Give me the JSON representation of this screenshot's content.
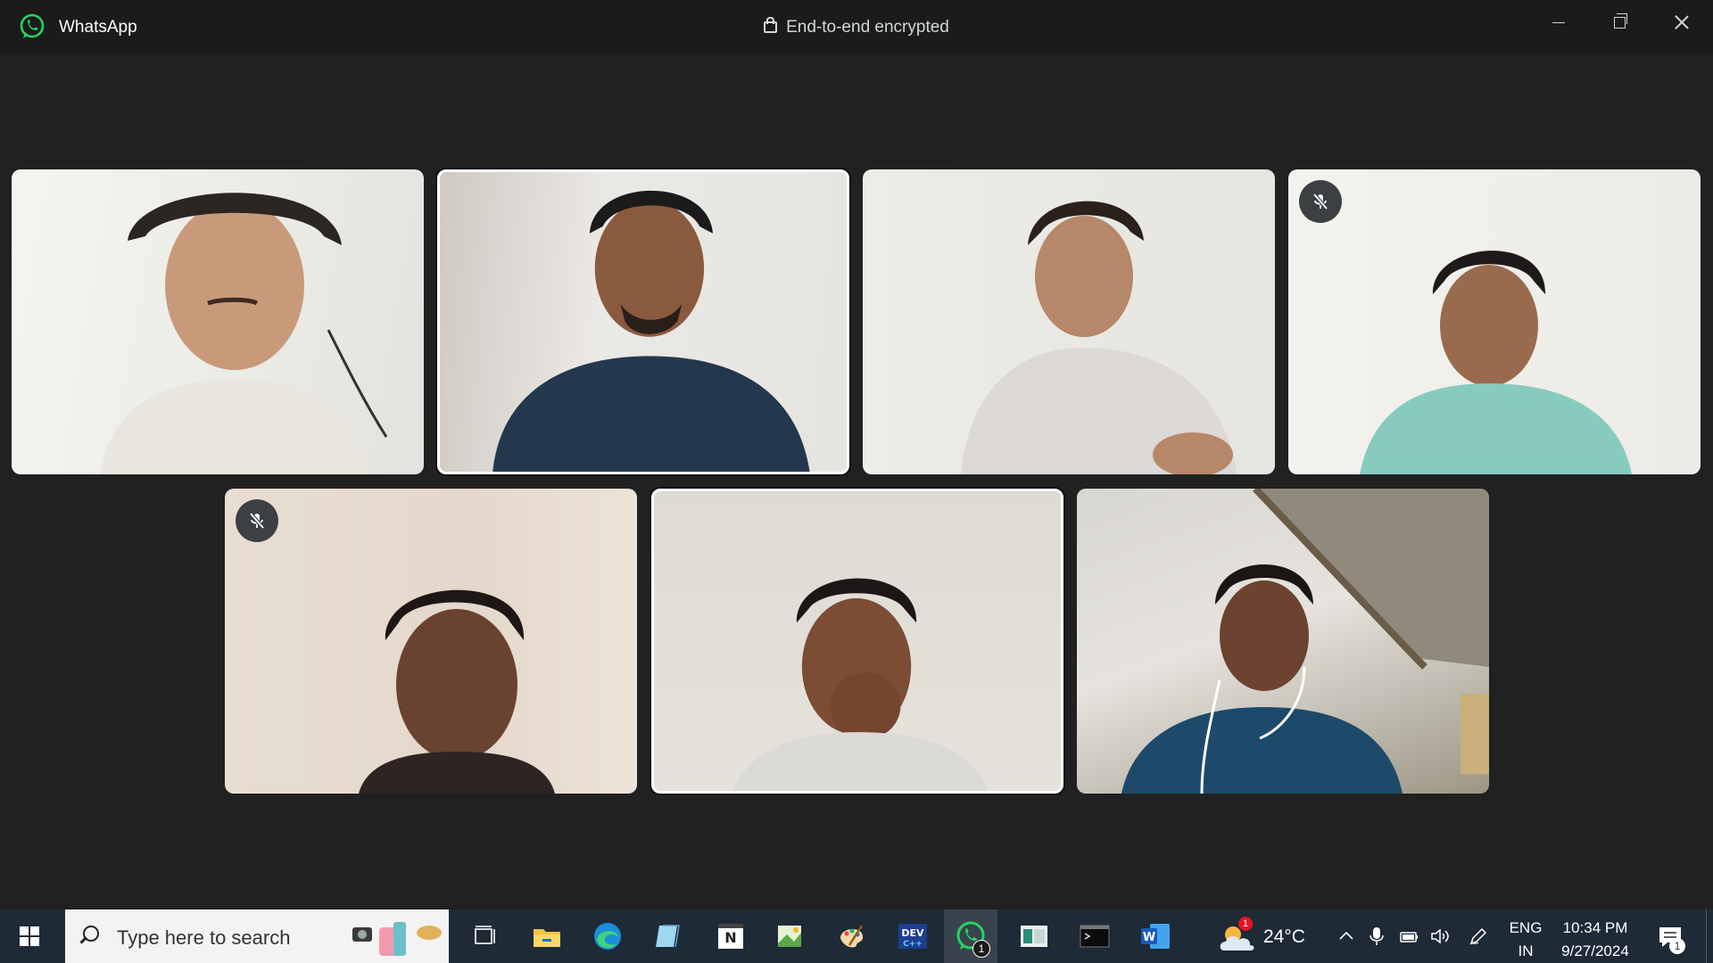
{
  "window": {
    "app_name": "WhatsApp",
    "encryption_label": "End-to-end encrypted",
    "controls": [
      "minimize-icon",
      "restore-icon",
      "close-icon"
    ]
  },
  "call": {
    "participants": [
      {
        "muted": false,
        "speaking": false
      },
      {
        "muted": false,
        "speaking": true
      },
      {
        "muted": false,
        "speaking": false
      },
      {
        "muted": true,
        "speaking": false
      },
      {
        "muted": true,
        "speaking": false
      },
      {
        "muted": false,
        "speaking": true
      },
      {
        "muted": false,
        "speaking": false
      }
    ]
  },
  "taskbar": {
    "search_placeholder": "Type here to search",
    "apps": [
      "task-view",
      "file-explorer",
      "edge",
      "notepad",
      "notepad-plus",
      "photos",
      "paint",
      "dev-cpp",
      "whatsapp",
      "screen-app",
      "terminal",
      "word"
    ],
    "whatsapp_badge": "1",
    "weather": {
      "temp": "24°C",
      "badge": "1"
    },
    "language": {
      "line1": "ENG",
      "line2": "IN"
    },
    "clock": {
      "time": "10:34 PM",
      "date": "9/27/2024"
    },
    "notifications_badge": "1"
  },
  "colors": {
    "whatsapp_green": "#25d366",
    "window_bg": "#212121",
    "taskbar_bg": "#1e2a36"
  }
}
